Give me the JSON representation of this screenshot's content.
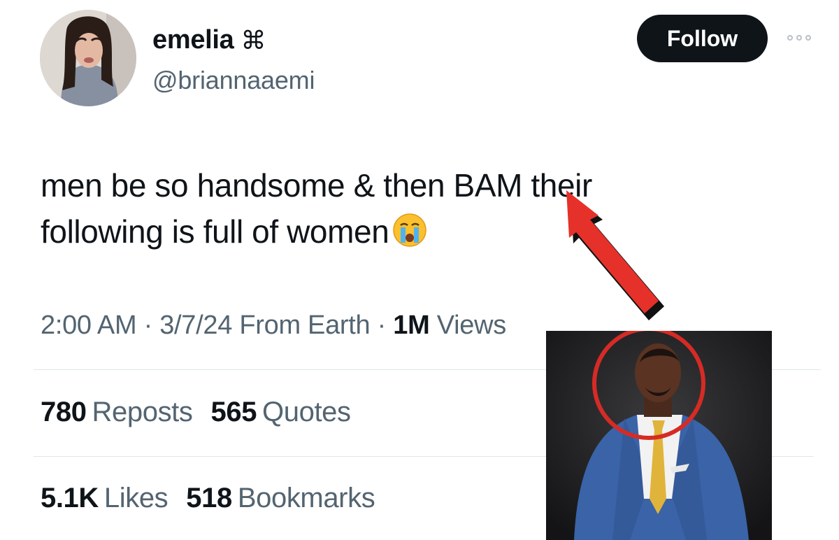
{
  "author": {
    "display_name": "emelia",
    "name_icon": "clover-icon",
    "name_glyph": "⌘",
    "handle": "@briannaaemi"
  },
  "follow_button": {
    "label": "Follow"
  },
  "more_menu": {
    "icon": "more-horizontal-icon"
  },
  "tweet": {
    "line1": "men be so handsome & then BAM their",
    "line2": "following is full of women",
    "emoji": "crying-face-emoji"
  },
  "meta": {
    "time": "2:00 AM",
    "date": "3/7/24",
    "source": "From Earth",
    "views_count": "1M",
    "views_label": "Views",
    "separator": "·"
  },
  "stats": {
    "reposts_count": "780",
    "reposts_label": "Reposts",
    "quotes_count": "565",
    "quotes_label": "Quotes",
    "likes_count": "5.1K",
    "likes_label": "Likes",
    "bookmarks_count": "518",
    "bookmarks_label": "Bookmarks"
  },
  "colors": {
    "text": "#0f1419",
    "secondary": "#536471",
    "follow_bg": "#0f1419",
    "arrow_red": "#e5312a",
    "circle_red": "#d62b25",
    "suit_blue": "#3a63a8",
    "tie_gold": "#e0b43a"
  }
}
